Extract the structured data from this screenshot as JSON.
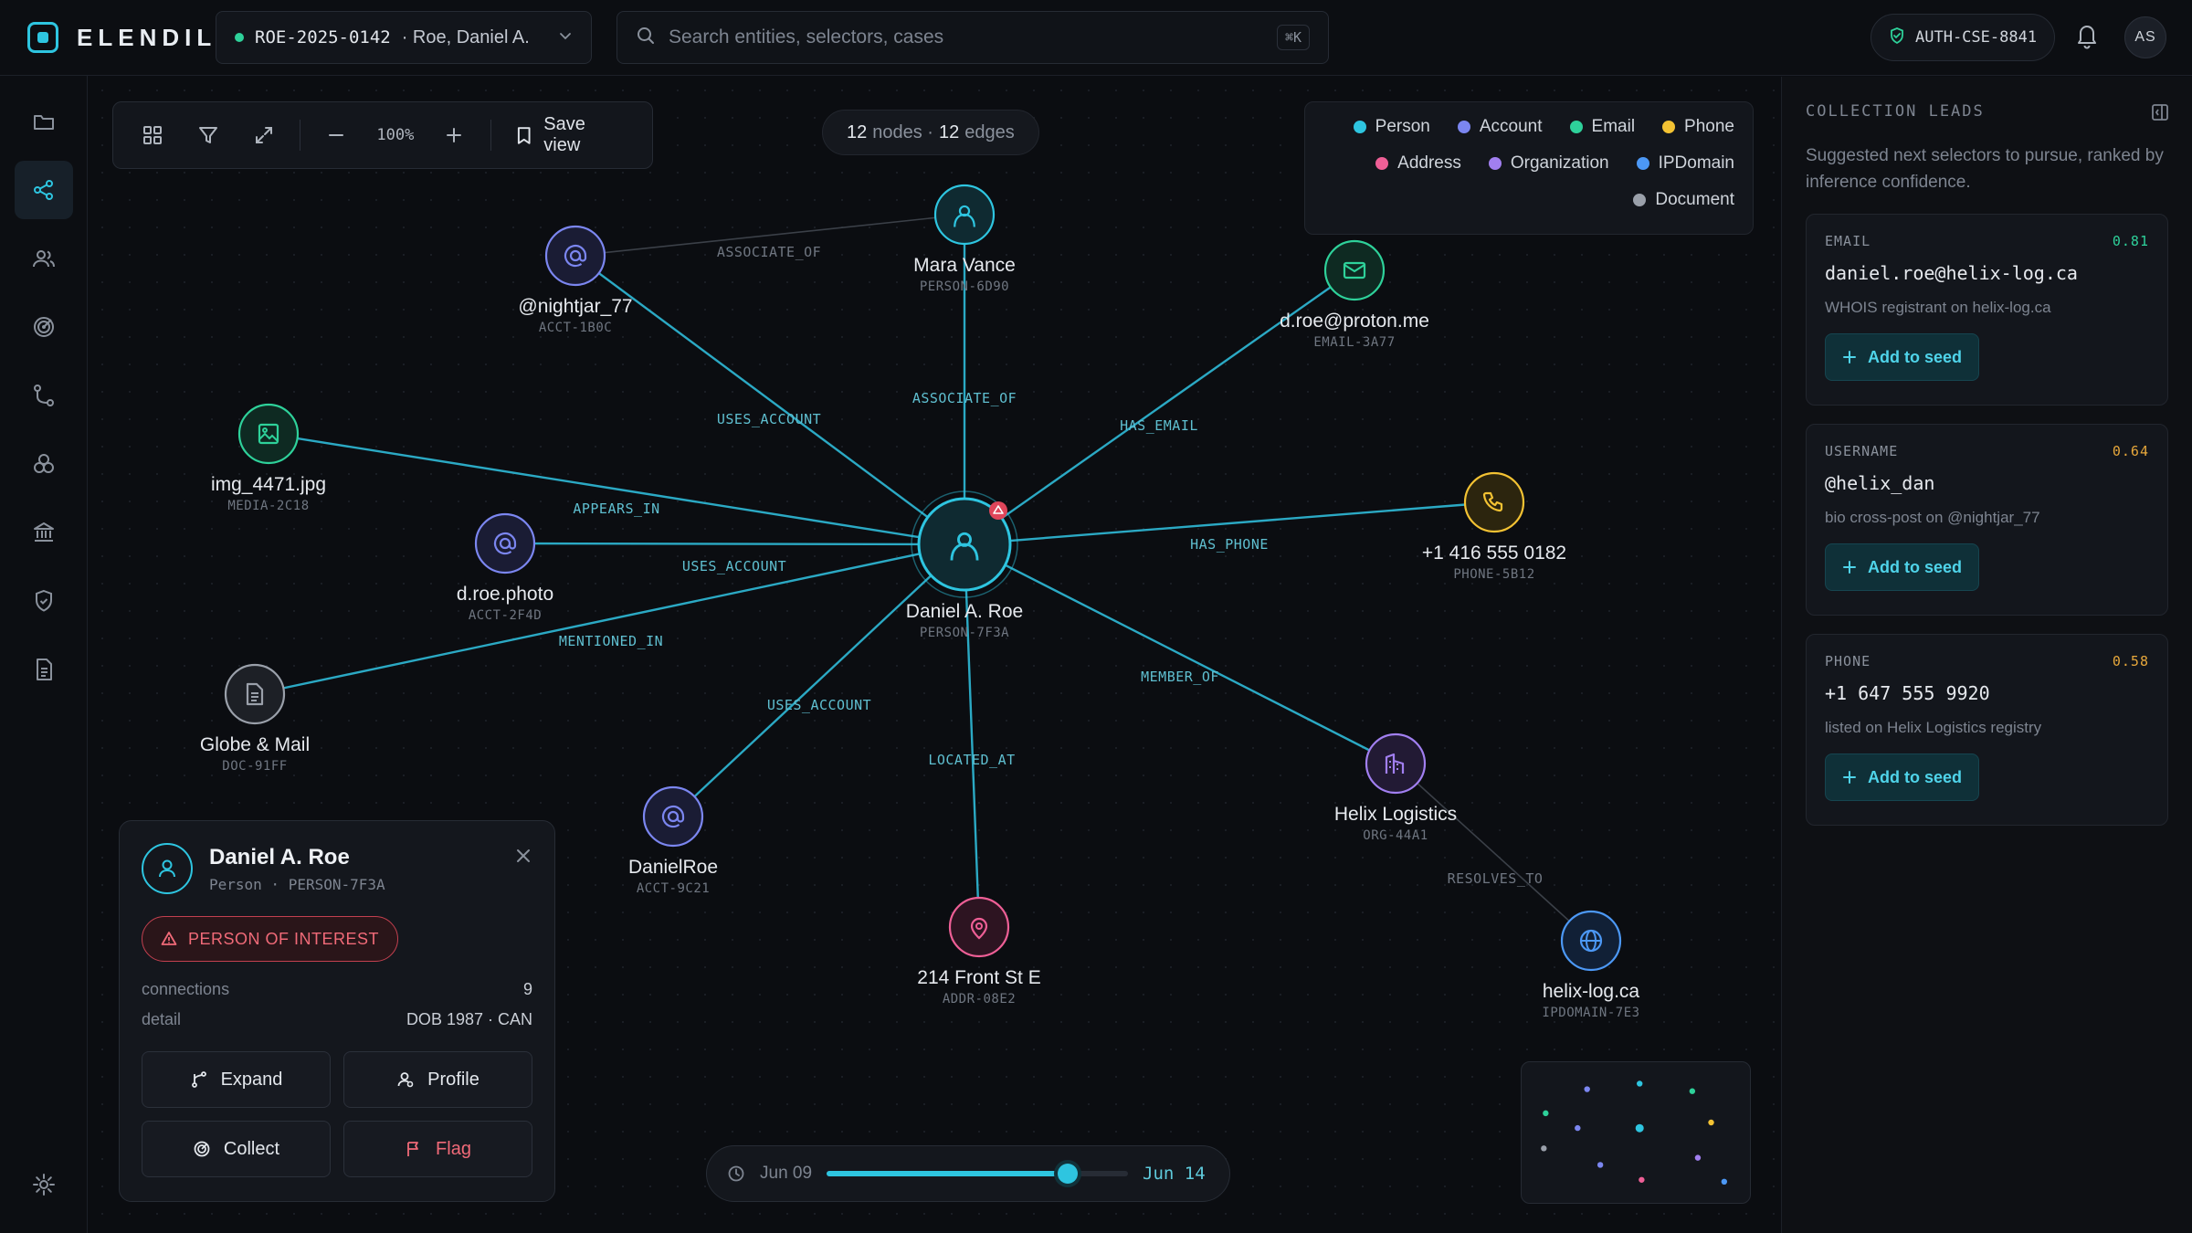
{
  "app": {
    "brand": "ELENDIL"
  },
  "case": {
    "id": "ROE-2025-0142",
    "name": "· Roe, Daniel A."
  },
  "search": {
    "placeholder": "Search entities, selectors, cases",
    "shortcut": "⌘K"
  },
  "auth": {
    "id": "AUTH-CSE-8841"
  },
  "user": {
    "initials": "AS"
  },
  "rail": {
    "items": [
      "folder-icon",
      "graph-icon",
      "people-icon",
      "target-icon",
      "route-icon",
      "cluster-icon",
      "bank-icon",
      "shield-icon",
      "document-icon"
    ],
    "active": 1,
    "settings": "gear-icon"
  },
  "toolbar": {
    "zoom": "100%",
    "save_label": "Save view"
  },
  "counts": {
    "nodes": "12",
    "nodes_label": "nodes ·",
    "edges": "12",
    "edges_label": "edges"
  },
  "legend": [
    {
      "label": "Person",
      "color": "#2ec5e0"
    },
    {
      "label": "Account",
      "color": "#7b86f0"
    },
    {
      "label": "Email",
      "color": "#2ed19a"
    },
    {
      "label": "Phone",
      "color": "#f3c233"
    },
    {
      "label": "Address",
      "color": "#ee5f96"
    },
    {
      "label": "Organization",
      "color": "#a17ff0"
    },
    {
      "label": "IPDomain",
      "color": "#4c98f5"
    },
    {
      "label": "Document",
      "color": "#9aa0aa"
    }
  ],
  "graph": {
    "nodes": [
      {
        "name": "Daniel A. Roe",
        "id": "PERSON-7F3A",
        "type": "Person",
        "icon": "person-icon",
        "alert": true
      },
      {
        "name": "Mara Vance",
        "id": "PERSON-6D90",
        "type": "Person",
        "icon": "person-icon"
      },
      {
        "name": "@nightjar_77",
        "id": "ACCT-1B0C",
        "type": "Account",
        "icon": "at-icon"
      },
      {
        "name": "d.roe@proton.me",
        "id": "EMAIL-3A77",
        "type": "Email",
        "icon": "mail-icon"
      },
      {
        "name": "img_4471.jpg",
        "id": "MEDIA-2C18",
        "type": "Media",
        "icon": "image-icon"
      },
      {
        "name": "d.roe.photo",
        "id": "ACCT-2F4D",
        "type": "Account",
        "icon": "at-icon"
      },
      {
        "name": "+1 416 555 0182",
        "id": "PHONE-5B12",
        "type": "Phone",
        "icon": "phone-icon"
      },
      {
        "name": "Globe & Mail",
        "id": "DOC-91FF",
        "type": "Document",
        "icon": "document-icon"
      },
      {
        "name": "DanielRoe",
        "id": "ACCT-9C21",
        "type": "Account",
        "icon": "at-icon"
      },
      {
        "name": "Helix Logistics",
        "id": "ORG-44A1",
        "type": "Organization",
        "icon": "building-icon"
      },
      {
        "name": "214 Front St E",
        "id": "ADDR-08E2",
        "type": "Address",
        "icon": "pin-icon"
      },
      {
        "name": "helix-log.ca",
        "id": "IPDOMAIN-7E3",
        "type": "IPDomain",
        "icon": "globe-icon"
      }
    ],
    "edges": [
      {
        "from": 0,
        "to": 1,
        "label": "ASSOCIATE_OF"
      },
      {
        "from": 2,
        "to": 1,
        "label": "ASSOCIATE_OF"
      },
      {
        "from": 0,
        "to": 2,
        "label": "USES_ACCOUNT"
      },
      {
        "from": 0,
        "to": 3,
        "label": "HAS_EMAIL"
      },
      {
        "from": 4,
        "to": 0,
        "label": "APPEARS_IN"
      },
      {
        "from": 0,
        "to": 5,
        "label": "USES_ACCOUNT"
      },
      {
        "from": 0,
        "to": 6,
        "label": "HAS_PHONE"
      },
      {
        "from": 0,
        "to": 7,
        "label": "MENTIONED_IN"
      },
      {
        "from": 0,
        "to": 8,
        "label": "USES_ACCOUNT"
      },
      {
        "from": 0,
        "to": 9,
        "label": "MEMBER_OF"
      },
      {
        "from": 0,
        "to": 10,
        "label": "LOCATED_AT"
      },
      {
        "from": 9,
        "to": 11,
        "label": "RESOLVES_TO"
      }
    ]
  },
  "entity_card": {
    "name": "Daniel A. Roe",
    "subtitle": "Person · PERSON-7F3A",
    "badge": "PERSON OF INTEREST",
    "rows": [
      {
        "key": "connections",
        "value": "9"
      },
      {
        "key": "detail",
        "value": "DOB 1987 · CAN"
      }
    ],
    "actions": [
      "Expand",
      "Profile",
      "Collect",
      "Flag"
    ]
  },
  "timeline": {
    "start": "Jun 09",
    "end": "Jun 14",
    "position": 0.8
  },
  "leads": {
    "title": "COLLECTION LEADS",
    "description": "Suggested next selectors to pursue, ranked by inference confidence.",
    "add_label": "Add to seed",
    "items": [
      {
        "type": "EMAIL",
        "score": "0.81",
        "value": "daniel.roe@helix-log.ca",
        "note": "WHOIS registrant on helix-log.ca"
      },
      {
        "type": "USERNAME",
        "score": "0.64",
        "value": "@helix_dan",
        "note": "bio cross-post on @nightjar_77"
      },
      {
        "type": "PHONE",
        "score": "0.58",
        "value": "+1 647 555 9920",
        "note": "listed on Helix Logistics registry"
      }
    ]
  }
}
